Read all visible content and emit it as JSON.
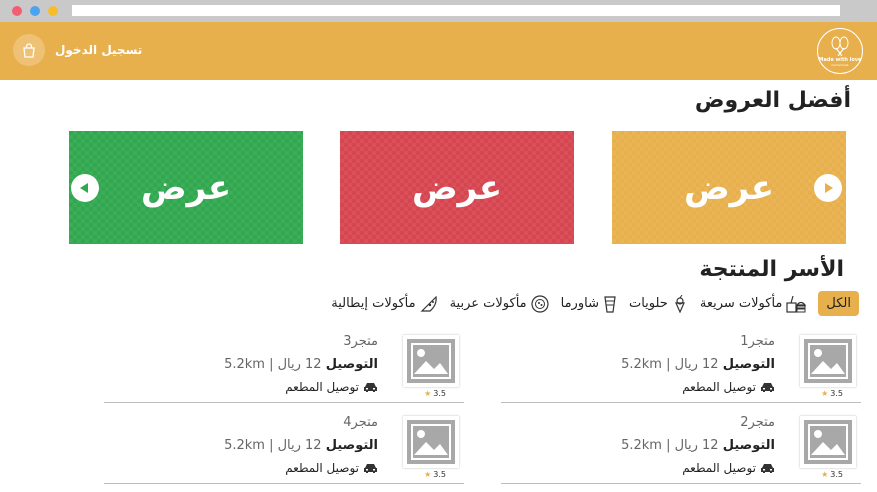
{
  "header": {
    "login_label": "تسجيل الدخول",
    "logo_text": "Made with love",
    "logo_subtext": "homemade",
    "bg_color": "#e8b04c"
  },
  "offers": {
    "title": "أفضل العروض",
    "banners": [
      {
        "label": "عرض",
        "color": "#e8b04c"
      },
      {
        "label": "عرض",
        "color": "#d64550"
      },
      {
        "label": "عرض",
        "color": "#31a84f"
      }
    ]
  },
  "families": {
    "title": "الأسر المنتجة",
    "categories": [
      {
        "label": "الكل",
        "icon": "all",
        "active": true
      },
      {
        "label": "مأكولات سريعة",
        "icon": "fast-food-icon"
      },
      {
        "label": "حلويات",
        "icon": "dessert-icon"
      },
      {
        "label": "شاورما",
        "icon": "shawarma-icon"
      },
      {
        "label": "مأكولات عربية",
        "icon": "arabic-food-icon"
      },
      {
        "label": "مأكولات إيطالية",
        "icon": "pizza-icon"
      }
    ],
    "stores": [
      {
        "name": "متجر1",
        "distance": "5.2km",
        "delivery_label": "التوصيل",
        "delivery_price": "12 ريال",
        "type": "توصيل المطعم",
        "rating": "3.5"
      },
      {
        "name": "متجر3",
        "distance": "5.2km",
        "delivery_label": "التوصيل",
        "delivery_price": "12 ريال",
        "type": "توصيل المطعم",
        "rating": "3.5"
      },
      {
        "name": "متجر2",
        "distance": "5.2km",
        "delivery_label": "التوصيل",
        "delivery_price": "12 ريال",
        "type": "توصيل المطعم",
        "rating": "3.5"
      },
      {
        "name": "متجر4",
        "distance": "5.2km",
        "delivery_label": "التوصيل",
        "delivery_price": "12 ريال",
        "type": "توصيل المطعم",
        "rating": "3.5"
      }
    ]
  }
}
